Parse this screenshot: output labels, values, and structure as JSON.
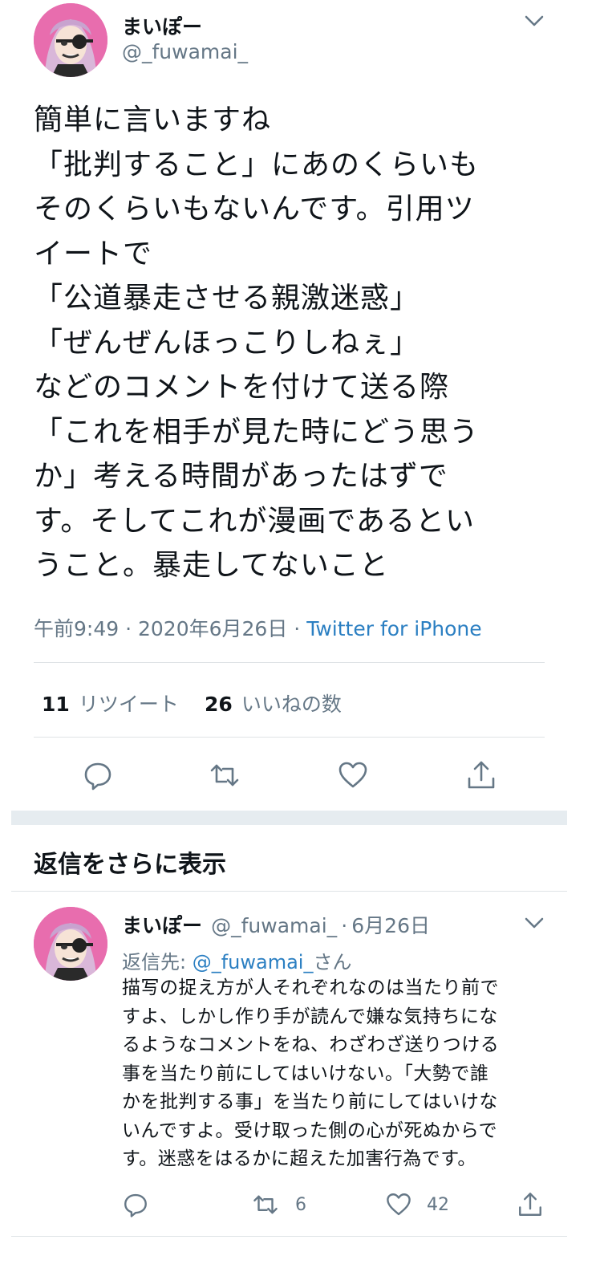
{
  "tweet": {
    "author_name": "まいぽー",
    "author_handle": "@_fuwamai_",
    "text": "簡単に言いますね\n「批判すること」にあのくらいも\nそのくらいもないんです。引用ツ\nイートで\n「公道暴走させる親激迷惑」\n「ぜんぜんほっこりしねぇ」\nなどのコメントを付けて送る際\n「これを相手が見た時にどう思う\nか」考える時間があったはずで\nす。そしてこれが漫画であるとい\nうこと。暴走してないこと",
    "time": "午前9:49",
    "date": "2020年6月26日",
    "separator": "·",
    "source": "Twitter for iPhone",
    "retweets_count": "11",
    "retweets_label": "リツイート",
    "likes_count": "26",
    "likes_label": "いいねの数"
  },
  "more_replies_label": "返信をさらに表示",
  "reply": {
    "author_name": "まいぽー",
    "author_handle": "@_fuwamai_",
    "separator": "·",
    "date": "6月26日",
    "reply_to_prefix": "返信先: ",
    "reply_to_handle": "@_fuwamai_",
    "reply_to_suffix": "さん",
    "text": "描写の捉え方が人それぞれなのは当たり前で\nすよ、しかし作り手が読んで嫌な気持ちにな\nるようなコメントをね、わざわざ送りつける\n事を当たり前にしてはいけない。「大勢で誰\nかを批判する事」を当たり前にしてはいけな\nいんですよ。受け取った側の心が死ぬからで\nす。迷惑をはるかに超えた加害行為です。",
    "retweet_count": "6",
    "like_count": "42"
  },
  "colors": {
    "accent": "#2b7fc2",
    "secondary_text": "#657786",
    "divider": "#dfe3e6",
    "section_gap": "#e6ecf0",
    "avatar_bg": "#e86dae"
  },
  "icons": [
    "chevron-down-icon",
    "reply-icon",
    "retweet-icon",
    "like-icon",
    "share-icon"
  ]
}
